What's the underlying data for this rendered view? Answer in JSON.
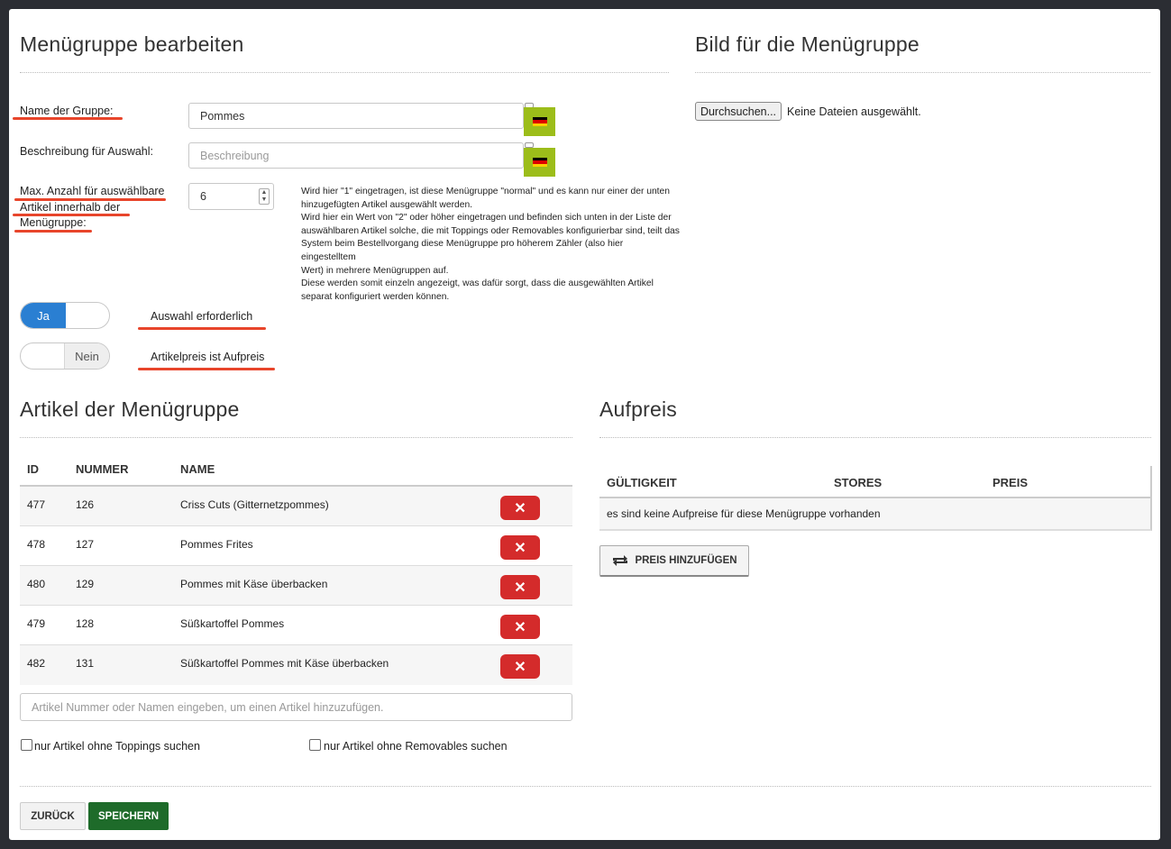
{
  "edit": {
    "title": "Menügruppe bearbeiten",
    "name_label": "Name der Gruppe:",
    "name_value": "Pommes",
    "desc_label": "Beschreibung für Auswahl:",
    "desc_placeholder": "Beschreibung",
    "max_label_1": "Max. Anzahl für auswählbare",
    "max_label_2": "Artikel innerhalb der",
    "max_label_3": "Menügruppe:",
    "max_value": "6",
    "help_lines": [
      "Wird hier \"1\" eingetragen, ist diese Menügruppe \"normal\" und es kann nur einer der unten",
      "hinzugefügten Artikel ausgewählt werden.",
      "Wird hier ein Wert von \"2\" oder höher eingetragen und befinden sich unten in der Liste der",
      "auswählbaren Artikel solche, die mit Toppings oder Removables konfigurierbar sind, teilt das",
      "System beim Bestellvorgang diese Menügruppe pro höherem Zähler (also hier eingestelltem",
      "Wert) in mehrere Menügruppen auf.",
      "Diese werden somit einzeln angezeigt, was dafür sorgt, dass die ausgewählten Artikel",
      "separat konfiguriert werden können."
    ],
    "toggle_required_state": "Ja",
    "toggle_required_label": "Auswahl erforderlich",
    "toggle_surcharge_state": "Nein",
    "toggle_surcharge_label": "Artikelpreis ist Aufpreis"
  },
  "image": {
    "title": "Bild für die Menügruppe",
    "browse_label": "Durchsuchen...",
    "no_file": "Keine Dateien ausgewählt."
  },
  "articles": {
    "title": "Artikel der Menügruppe",
    "headers": {
      "id": "ID",
      "number": "NUMMER",
      "name": "NAME"
    },
    "rows": [
      {
        "id": "477",
        "number": "126",
        "name": "Criss Cuts (Gitternetzpommes)"
      },
      {
        "id": "478",
        "number": "127",
        "name": "Pommes Frites"
      },
      {
        "id": "480",
        "number": "129",
        "name": "Pommes mit Käse überbacken"
      },
      {
        "id": "479",
        "number": "128",
        "name": "Süßkartoffel Pommes"
      },
      {
        "id": "482",
        "number": "131",
        "name": "Süßkartoffel Pommes mit Käse überbacken"
      }
    ],
    "delete_glyph": "✕",
    "search_placeholder": "Artikel Nummer oder Namen eingeben, um einen Artikel hinzuzufügen.",
    "filter_toppings": "nur Artikel ohne Toppings suchen",
    "filter_removables": "nur Artikel ohne Removables suchen"
  },
  "surcharge": {
    "title": "Aufpreis",
    "headers": {
      "validity": "GÜLTIGKEIT",
      "stores": "STORES",
      "price": "PREIS"
    },
    "empty_text": "es sind keine Aufpreise für diese Menügruppe vorhanden",
    "add_label": "PREIS HINZUFÜGEN"
  },
  "footer": {
    "back_label": "ZURÜCK",
    "save_label": "SPEICHERN"
  },
  "colors": {
    "accent_blue": "#2a7fd2",
    "flag_green": "#9cbd1a",
    "delete_red": "#d42b2b",
    "save_green": "#1e6b2a",
    "annotation_red": "#e8452b"
  },
  "icons": [
    "flag-de-icon",
    "close-icon",
    "refresh-icon"
  ]
}
